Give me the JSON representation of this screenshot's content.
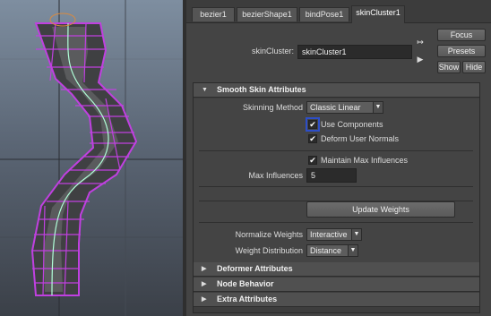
{
  "tabs": [
    {
      "label": "bezier1"
    },
    {
      "label": "bezierShape1"
    },
    {
      "label": "bindPose1"
    },
    {
      "label": "skinCluster1"
    }
  ],
  "node": {
    "label": "skinCluster:",
    "value": "skinCluster1",
    "focus_label": "Focus",
    "presets_label": "Presets",
    "show_label": "Show",
    "hide_label": "Hide"
  },
  "smooth_skin": {
    "title": "Smooth Skin Attributes",
    "skinning_method_label": "Skinning Method",
    "skinning_method_value": "Classic Linear",
    "use_components_label": "Use Components",
    "use_components_checked": true,
    "deform_user_normals_label": "Deform User Normals",
    "deform_user_normals_checked": true,
    "maintain_max_label": "Maintain Max Influences",
    "maintain_max_checked": true,
    "max_influences_label": "Max Influences",
    "max_influences_value": "5",
    "update_weights_label": "Update Weights",
    "normalize_weights_label": "Normalize Weights",
    "normalize_weights_value": "Interactive",
    "weight_distribution_label": "Weight Distribution",
    "weight_distribution_value": "Distance"
  },
  "collapsed_sections": [
    {
      "title": "Deformer Attributes"
    },
    {
      "title": "Node Behavior"
    },
    {
      "title": "Extra Attributes"
    }
  ],
  "icons": {
    "expanded": "▼",
    "collapsed": "▶",
    "checkmark": "✔",
    "dropdown": "▼",
    "input_arrow": "↦",
    "output_arrow": "▶"
  },
  "colors": {
    "wireframe": "#c040e0",
    "curve": "#b0ffd8",
    "selection_highlight": "#2d4ec8"
  }
}
